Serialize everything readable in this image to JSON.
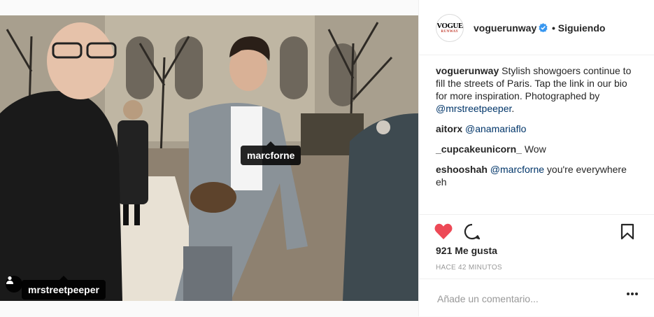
{
  "post": {
    "photo_tags": [
      {
        "label": "marcforne"
      },
      {
        "label": "mrstreetpeeper"
      }
    ],
    "header": {
      "avatar_text_line1": "VOGUE",
      "avatar_text_line2": "RUNWAY",
      "username": "voguerunway",
      "separator": "•",
      "follow_status": "Siguiendo"
    },
    "caption": {
      "user": "voguerunway",
      "text": "Stylish showgoers continue to fill the streets of Paris. Tap the link in our bio for more inspiration. Photographed by ",
      "mention": "@mrstreetpeeper",
      "end": "."
    },
    "comments": [
      {
        "user": "aitorx",
        "mention": "@anamariaflo",
        "text": ""
      },
      {
        "user": "_cupcakeunicorn_",
        "mention": "",
        "text": "Wow"
      },
      {
        "user": "eshooshah",
        "mention": "@marcforne",
        "text": "you're everywhere eh"
      }
    ],
    "likes": "921 Me gusta",
    "timestamp": "HACE 42 MINUTOS",
    "comment_input": {
      "placeholder": "Añade un comentario...",
      "value": ""
    },
    "icons": {
      "like": "heart-icon",
      "comment": "comment-icon",
      "save": "bookmark-icon",
      "options": "more-options-icon",
      "verified": "verified-badge-icon",
      "user_tag": "user-tag-icon"
    },
    "colors": {
      "like_active": "#ed4956",
      "verified": "#3897f0",
      "mention": "#003569",
      "muted": "#999999",
      "border": "#efefef"
    }
  }
}
